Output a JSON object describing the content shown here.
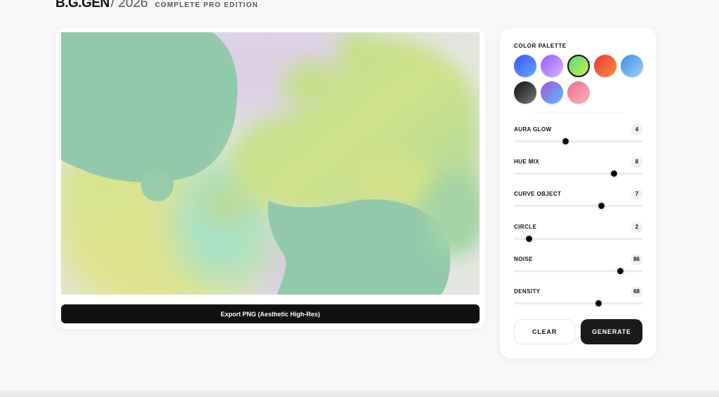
{
  "header": {
    "brand": "B.G.GEN",
    "year": "/ 2026",
    "edition": "COMPLETE PRO EDITION"
  },
  "preview": {
    "export_label": "Export PNG (Aesthetic High-Res)"
  },
  "panel": {
    "palette_title": "COLOR PALETTE",
    "swatches": [
      {
        "name": "blue",
        "from": "#2d5bff",
        "to": "#6fa0ff",
        "active": false
      },
      {
        "name": "purple",
        "from": "#9b5cf6",
        "to": "#d0b4ff",
        "active": false
      },
      {
        "name": "lime",
        "from": "#55d86a",
        "to": "#c8f060",
        "active": true
      },
      {
        "name": "red-orange",
        "from": "#e53935",
        "to": "#ff8a3d",
        "active": false
      },
      {
        "name": "sky",
        "from": "#3b8fe0",
        "to": "#9ed2f5",
        "active": false
      },
      {
        "name": "charcoal",
        "from": "#111111",
        "to": "#777777",
        "active": false
      },
      {
        "name": "violet-cyan",
        "from": "#b04ee0",
        "to": "#4fc3f7",
        "active": false
      },
      {
        "name": "pink",
        "from": "#f06a8a",
        "to": "#f7b4c0",
        "active": false
      }
    ],
    "sliders": [
      {
        "label": "AURA GLOW",
        "value": "4",
        "fraction": 0.4
      },
      {
        "label": "HUE MIX",
        "value": "8",
        "fraction": 0.78
      },
      {
        "label": "CURVE OBJECT",
        "value": "7",
        "fraction": 0.68
      },
      {
        "label": "CIRCLE",
        "value": "2",
        "fraction": 0.12
      },
      {
        "label": "NOISE",
        "value": "86",
        "fraction": 0.83
      },
      {
        "label": "DENSITY",
        "value": "68",
        "fraction": 0.66
      }
    ],
    "clear_label": "CLEAR",
    "generate_label": "GENERATE"
  },
  "colors": {
    "accent_dark": "#111111",
    "blob_green": "#93c9ab",
    "blob_lime": "#c9df8a",
    "blob_yellow": "#dfe38f",
    "blob_mint": "#a5e2c8",
    "canvas_bg": "#e2e5de",
    "lavender": "#dcd0e6"
  }
}
